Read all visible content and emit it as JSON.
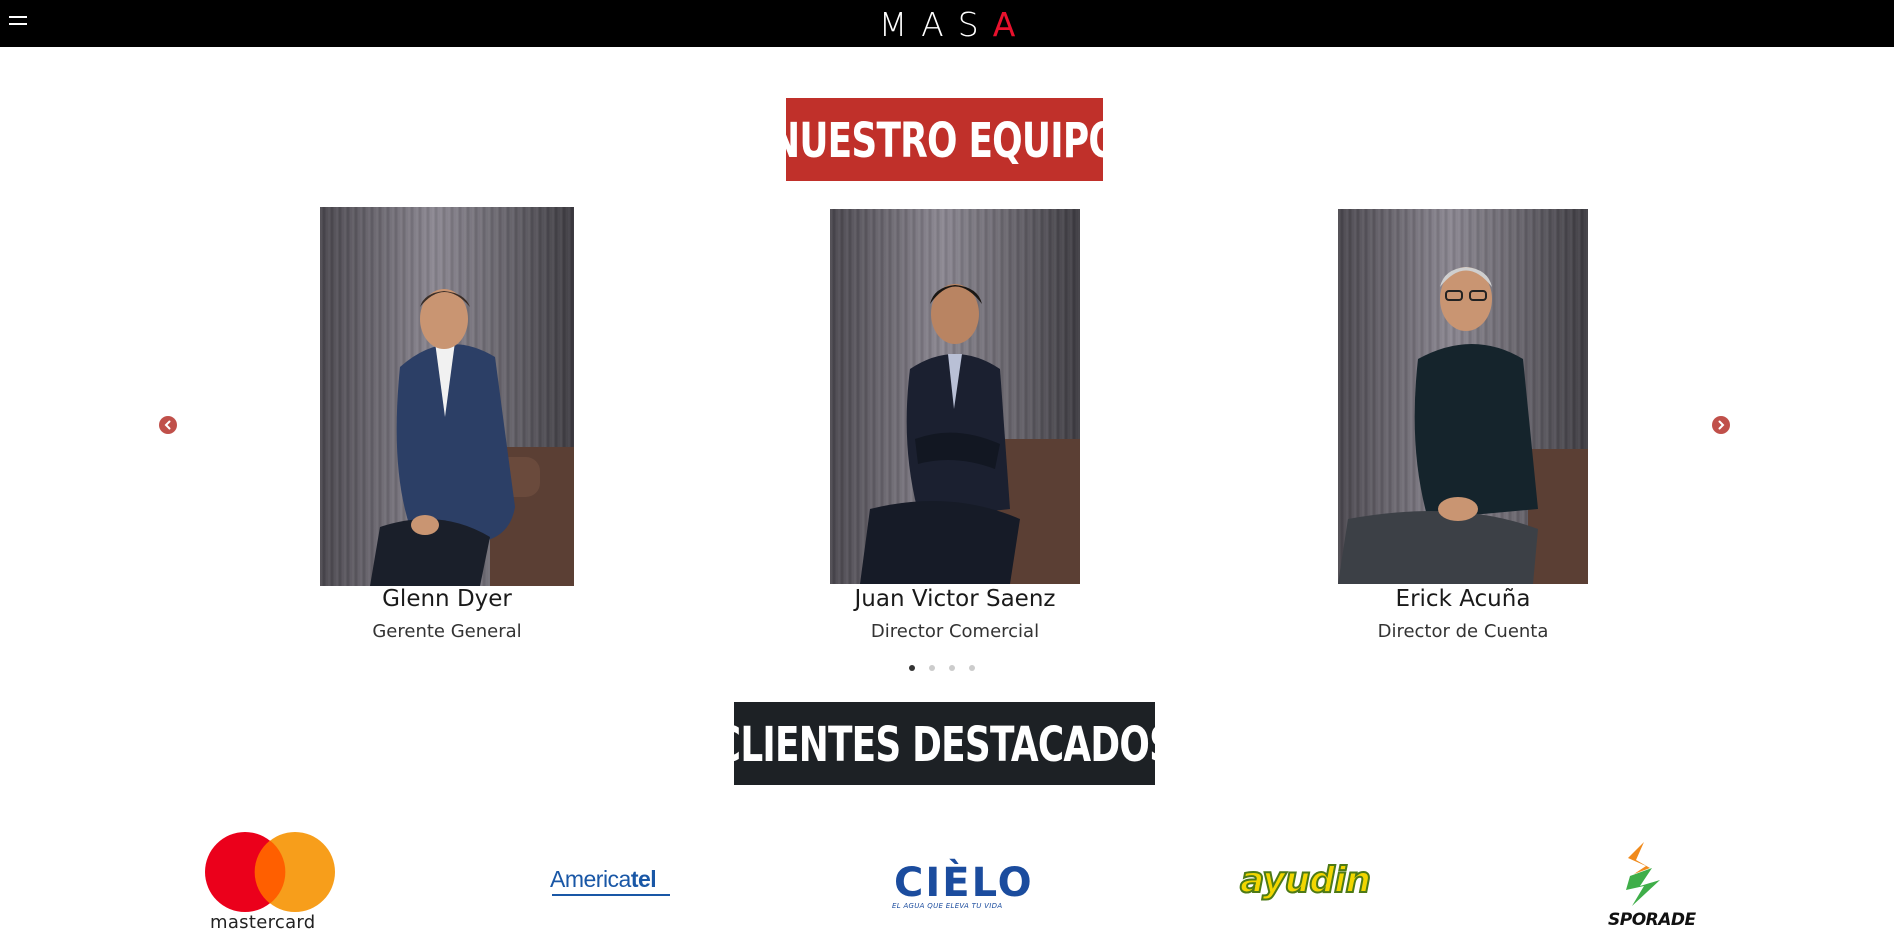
{
  "header": {
    "logo_main": "MAS",
    "logo_accent": "A",
    "menu_icon": "hamburger-menu-icon"
  },
  "team": {
    "title": "NUESTRO EQUIPO",
    "members": [
      {
        "name": "Glenn Dyer",
        "role": "Gerente General"
      },
      {
        "name": "Juan Victor Saenz",
        "role": "Director Comercial"
      },
      {
        "name": "Erick Acuña",
        "role": "Director de Cuenta"
      }
    ],
    "carousel": {
      "pages": 4,
      "active_page": 1,
      "prev_icon": "chevron-left-icon",
      "next_icon": "chevron-right-icon"
    }
  },
  "clients": {
    "title": "CLIENTES DESTACADOS",
    "logos": [
      {
        "name": "mastercard",
        "text": "mastercard",
        "suffix": "."
      },
      {
        "name": "americatel",
        "text_a": "America",
        "text_b": "tel"
      },
      {
        "name": "cielo",
        "text": "CIÈLO",
        "tagline": "EL AGUA QUE ELEVA TU VIDA"
      },
      {
        "name": "ayudin",
        "text": "ayudin"
      },
      {
        "name": "sporade",
        "text": "SPORADE"
      }
    ]
  },
  "colors": {
    "header_bg": "#000000",
    "accent_red": "#e8112d",
    "team_title_bg": "#c0302a",
    "clients_title_bg": "#1d2125",
    "arrow": "#c0504a"
  }
}
